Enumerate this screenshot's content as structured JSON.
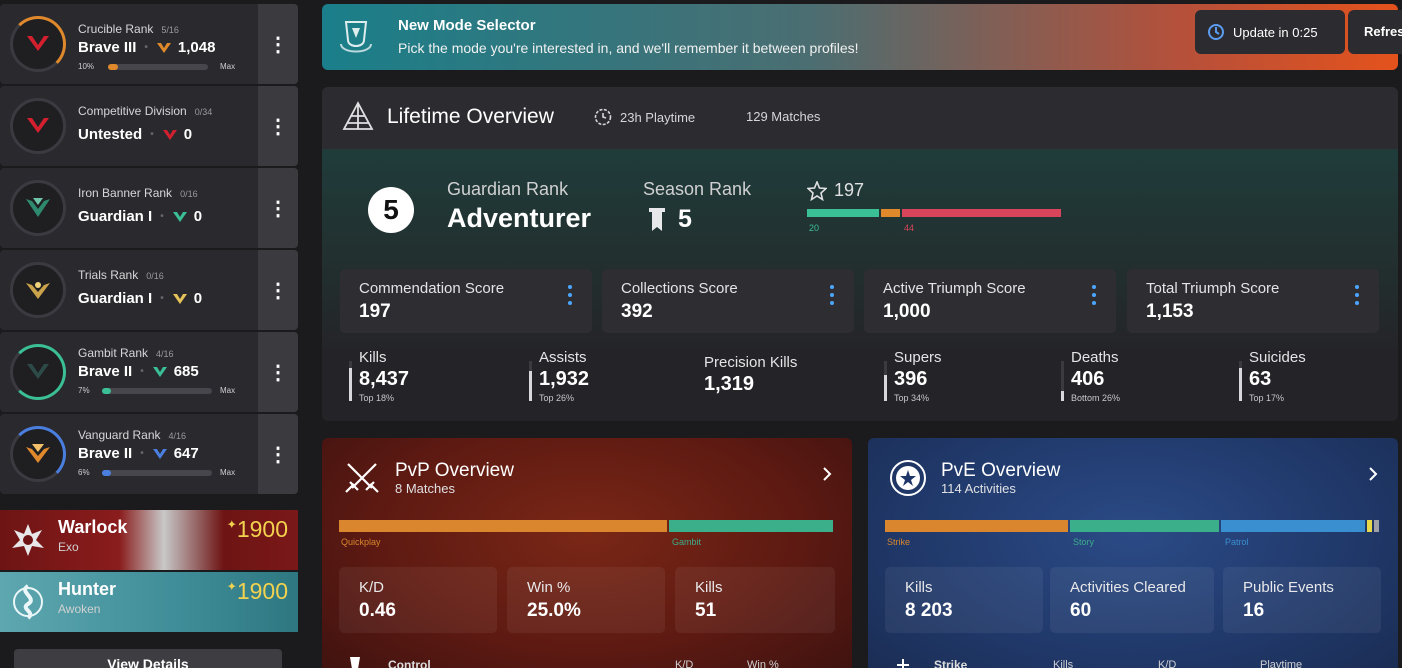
{
  "ranks": [
    {
      "name": "Crucible Rank",
      "count": "5/16",
      "title": "Brave III",
      "value": "1,048",
      "pct": "10%",
      "progress": 0.1,
      "max": "Max",
      "color": "#e0892c"
    },
    {
      "name": "Competitive Division",
      "count": "0/34",
      "title": "Untested",
      "value": "0",
      "color": "#d4202e"
    },
    {
      "name": "Iron Banner Rank",
      "count": "0/16",
      "title": "Guardian I",
      "value": "0",
      "color": "#3bbf95"
    },
    {
      "name": "Trials Rank",
      "count": "0/16",
      "title": "Guardian I",
      "value": "0",
      "color": "#e6c35a"
    },
    {
      "name": "Gambit Rank",
      "count": "4/16",
      "title": "Brave II",
      "value": "685",
      "pct": "7%",
      "progress": 0.07,
      "max": "Max",
      "color": "#3bbf95"
    },
    {
      "name": "Vanguard Rank",
      "count": "4/16",
      "title": "Brave II",
      "value": "647",
      "pct": "6%",
      "progress": 0.06,
      "max": "Max",
      "color": "#4a7fe0"
    }
  ],
  "characters": [
    {
      "class": "Warlock",
      "race": "Exo",
      "light": "1900"
    },
    {
      "class": "Hunter",
      "race": "Awoken",
      "light": "1900"
    }
  ],
  "view_details": "View Details",
  "banner": {
    "title": "New Mode Selector",
    "text": "Pick the mode you're interested in, and we'll remember it between profiles!"
  },
  "update": "Update in 0:25",
  "refresh": "Refres",
  "lifetime": {
    "title": "Lifetime Overview",
    "playtime": "23h Playtime",
    "matches": "129 Matches",
    "guardian_rank_num": "5",
    "guardian_rank_label": "Guardian Rank",
    "guardian_rank_value": "Adventurer",
    "season_rank_label": "Season Rank",
    "season_rank_value": "5",
    "commendations": "197",
    "commendation_breakdown": [
      {
        "label": "20",
        "value": 20,
        "color": "#3bbf95"
      },
      {
        "label": "",
        "value": 5,
        "color": "#e0892c"
      },
      {
        "label": "44",
        "value": 44,
        "color": "#d8455a"
      }
    ],
    "scores": [
      {
        "label": "Commendation Score",
        "value": "197"
      },
      {
        "label": "Collections Score",
        "value": "392"
      },
      {
        "label": "Active Triumph Score",
        "value": "1,000"
      },
      {
        "label": "Total Triumph Score",
        "value": "1,153"
      }
    ],
    "stats": [
      {
        "label": "Kills",
        "value": "8,437",
        "pct": "Top 18%",
        "level": 0.82
      },
      {
        "label": "Assists",
        "value": "1,932",
        "pct": "Top 26%",
        "level": 0.74
      },
      {
        "label": "Precision Kills",
        "value": "1,319",
        "pct": ""
      },
      {
        "label": "Supers",
        "value": "396",
        "pct": "Top 34%",
        "level": 0.66
      },
      {
        "label": "Deaths",
        "value": "406",
        "pct": "Bottom 26%",
        "level": 0.26
      },
      {
        "label": "Suicides",
        "value": "63",
        "pct": "Top 17%",
        "level": 0.83
      }
    ]
  },
  "pvp": {
    "title": "PvP Overview",
    "subtitle": "8 Matches",
    "bar": [
      {
        "label": "Quickplay",
        "value": 6,
        "color": "#d9862e"
      },
      {
        "label": "Gambit",
        "value": 3,
        "color": "#3bae8a"
      }
    ],
    "cards": [
      {
        "label": "K/D",
        "value": "0.46"
      },
      {
        "label": "Win %",
        "value": "25.0%"
      },
      {
        "label": "Kills",
        "value": "51"
      }
    ],
    "sub_title": "Control",
    "sub_cols": [
      "K/D",
      "Win %"
    ]
  },
  "pve": {
    "title": "PvE Overview",
    "subtitle": "114 Activities",
    "bar": [
      {
        "label": "Strike",
        "value": 37,
        "color": "#d9862e"
      },
      {
        "label": "Story",
        "value": 30,
        "color": "#3bae8a"
      },
      {
        "label": "Patrol",
        "value": 29,
        "color": "#3a8fd0"
      },
      {
        "label": "",
        "value": 1,
        "color": "#e8d94a"
      },
      {
        "label": "",
        "value": 1,
        "color": "#a0a0a8"
      }
    ],
    "cards": [
      {
        "label": "Kills",
        "value": "8 203"
      },
      {
        "label": "Activities Cleared",
        "value": "60"
      },
      {
        "label": "Public Events",
        "value": "16"
      }
    ],
    "sub_title": "Strike",
    "sub_cols": [
      "Kills",
      "K/D",
      "Playtime"
    ]
  }
}
